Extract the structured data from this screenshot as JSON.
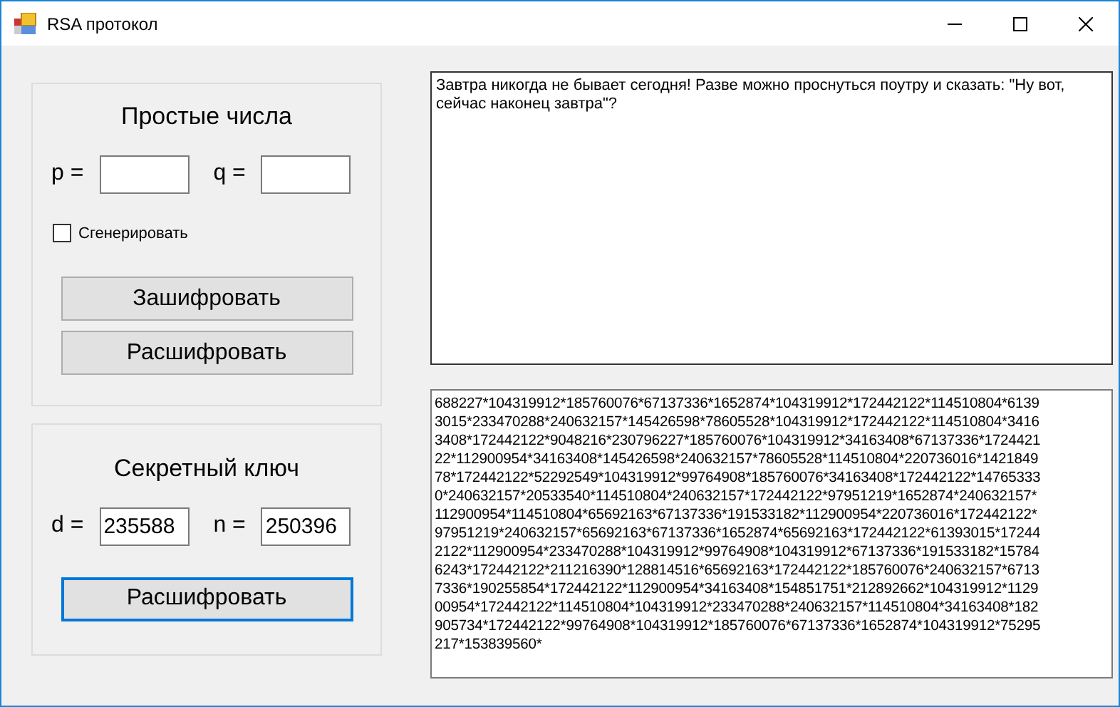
{
  "window": {
    "title": "RSA протокол"
  },
  "primes": {
    "title": "Простые числа",
    "p_label": "p =",
    "q_label": "q =",
    "generate": {
      "label": "Сгенерировать",
      "checked": false
    },
    "buttons": [
      {
        "label": "Зашифровать",
        "focused": false
      },
      {
        "label": "Расшифровать",
        "focused": false
      }
    ]
  },
  "secret_key": {
    "title": "Секретный ключ",
    "d_label": "d =",
    "d_value": "235588",
    "n_label": "n =",
    "n_value": "250396",
    "button": {
      "label": "Расшифровать",
      "focused": true
    }
  },
  "plaintext": "Завтра никогда не бывает сегодня! Разве можно проснуться поутру и сказать: \"Ну вот, сейчас наконец завтра\"?",
  "ciphertext_lines": [
    "688227*104319912*185760076*67137336*1652874*104319912*172442122*114510804*6139",
    "3015*233470288*240632157*145426598*78605528*104319912*172442122*114510804*3416",
    "3408*172442122*9048216*230796227*185760076*104319912*34163408*67137336*1724421",
    "22*112900954*34163408*145426598*240632157*78605528*114510804*220736016*1421849",
    "78*172442122*52292549*104319912*99764908*185760076*34163408*172442122*14765333",
    "0*240632157*20533540*114510804*240632157*172442122*97951219*1652874*240632157*",
    "112900954*114510804*65692163*67137336*191533182*112900954*220736016*172442122*",
    "97951219*240632157*65692163*67137336*1652874*65692163*172442122*61393015*17244",
    "2122*112900954*233470288*104319912*99764908*104319912*67137336*191533182*15784",
    "6243*172442122*211216390*128814516*65692163*172442122*185760076*240632157*6713",
    "7336*190255854*172442122*112900954*34163408*154851751*212892662*104319912*1129",
    "00954*172442122*114510804*104319912*233470288*240632157*114510804*34163408*182",
    "905734*172442122*99764908*104319912*185760076*67137336*1652874*104319912*75295",
    "217*153839560*"
  ]
}
